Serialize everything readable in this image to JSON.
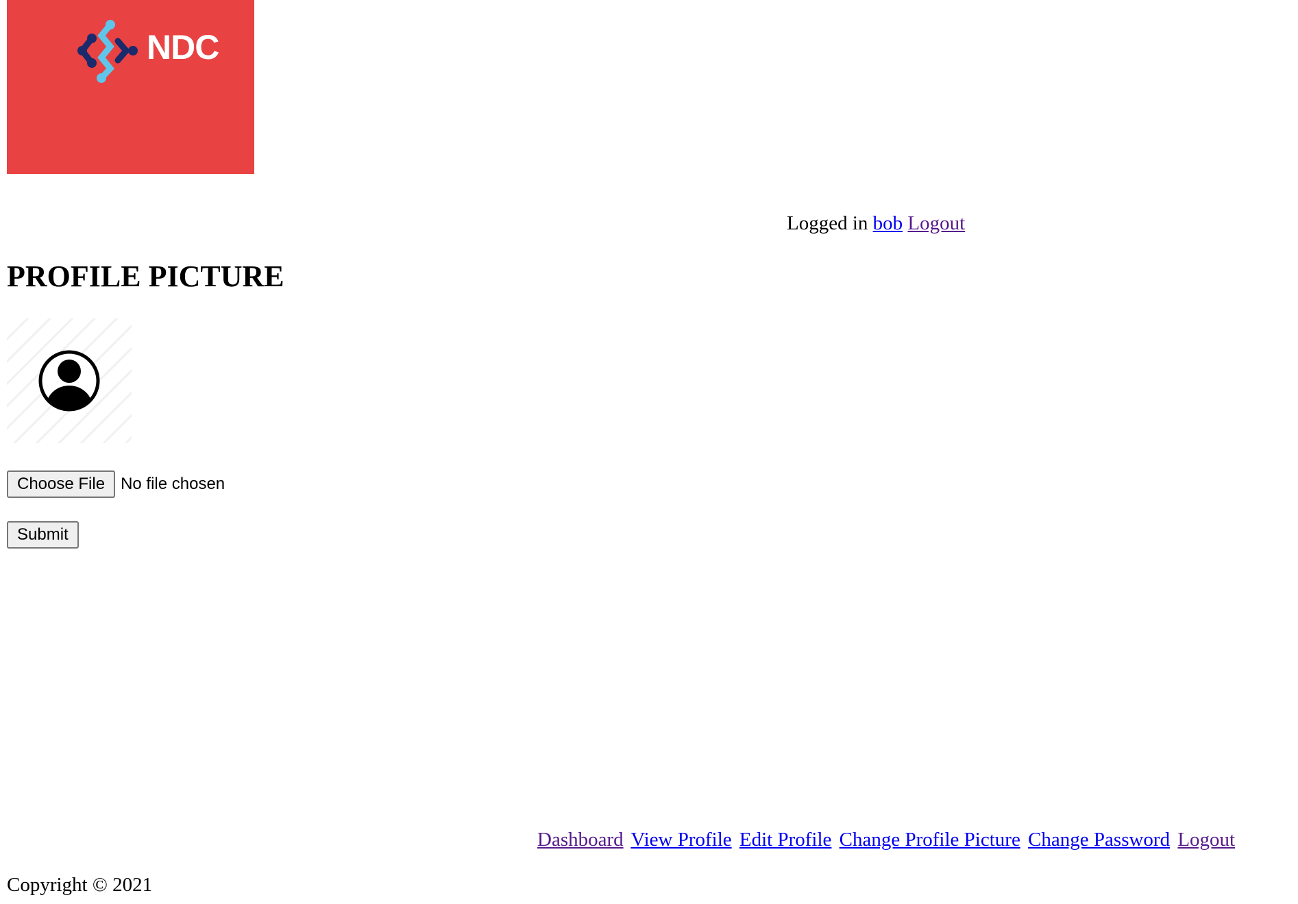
{
  "logo": {
    "text": "NDC"
  },
  "header": {
    "logged_in_label": "Logged in",
    "username": "bob",
    "logout_label": "Logout"
  },
  "main": {
    "title": "PROFILE PICTURE",
    "file_input": {
      "button_label": "Choose File",
      "status": "No file chosen"
    },
    "submit_label": "Submit"
  },
  "footer": {
    "nav": [
      {
        "label": "Dashboard"
      },
      {
        "label": "View Profile"
      },
      {
        "label": "Edit Profile"
      },
      {
        "label": "Change Profile Picture"
      },
      {
        "label": "Change Password"
      },
      {
        "label": "Logout"
      }
    ],
    "copyright": "Copyright © 2021"
  },
  "colors": {
    "logo_background": "#e84242",
    "link": "#0000ee",
    "visited_link": "#551a8b"
  }
}
